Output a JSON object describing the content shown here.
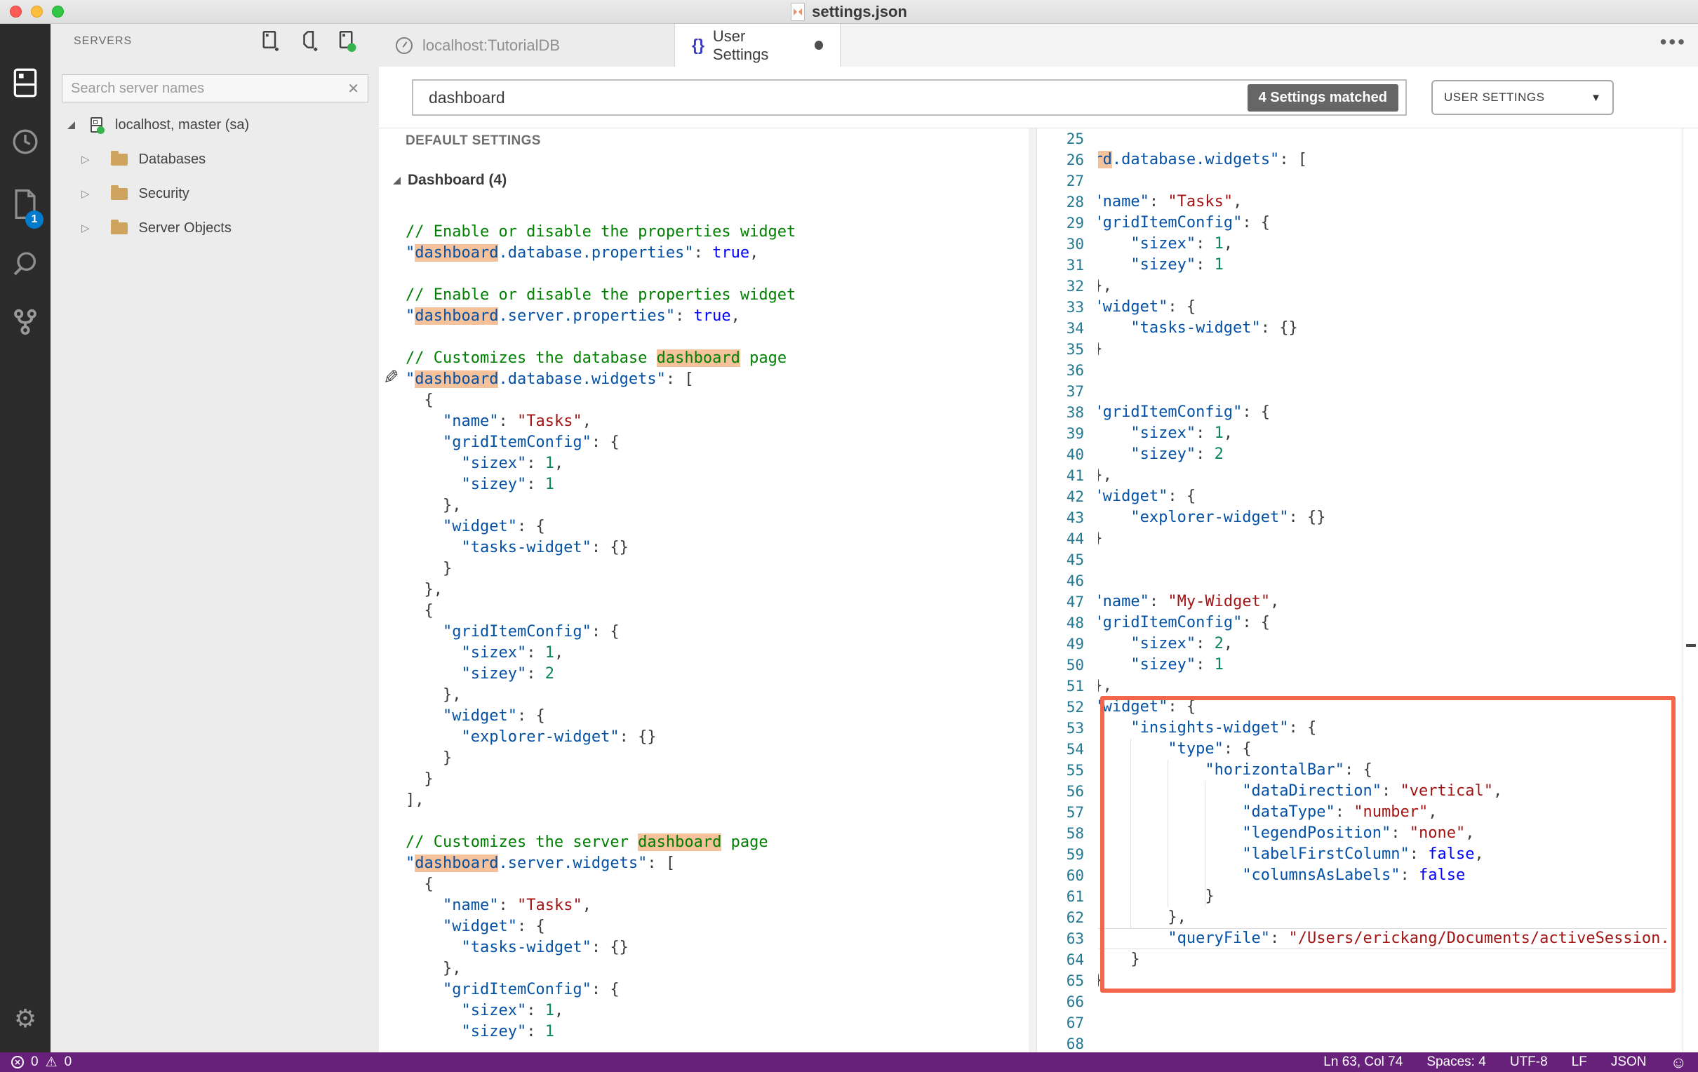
{
  "window": {
    "title": "settings.json"
  },
  "activity_bar": {
    "open_badge": "1"
  },
  "sidebar": {
    "title": "SERVERS",
    "search_placeholder": "Search server names",
    "tree": [
      {
        "label": "localhost, master (sa)"
      },
      {
        "label": "Databases"
      },
      {
        "label": "Security"
      },
      {
        "label": "Server Objects"
      }
    ]
  },
  "tabs": {
    "tab1": {
      "label": "localhost:TutorialDB"
    },
    "tab2": {
      "label": "User Settings"
    }
  },
  "settings_editor": {
    "query": "dashboard",
    "matched_badge": "4 Settings matched",
    "scope": "USER SETTINGS",
    "scope_caret": "▼"
  },
  "left_pane": {
    "header": "DEFAULT SETTINGS",
    "group_label": "Dashboard (4)",
    "lines": [
      [
        [
          "c",
          "// Enable or disable the properties widget"
        ]
      ],
      [
        [
          "k",
          "\""
        ],
        [
          "hk",
          "dashboard"
        ],
        [
          "k",
          ".database.properties\""
        ],
        [
          "p",
          ": "
        ],
        [
          "b",
          "true"
        ],
        [
          "p",
          ","
        ]
      ],
      [],
      [
        [
          "c",
          "// Enable or disable the properties widget"
        ]
      ],
      [
        [
          "k",
          "\""
        ],
        [
          "hk",
          "dashboard"
        ],
        [
          "k",
          ".server.properties\""
        ],
        [
          "p",
          ": "
        ],
        [
          "b",
          "true"
        ],
        [
          "p",
          ","
        ]
      ],
      [],
      [
        [
          "c",
          "// Customizes the database "
        ],
        [
          "hc",
          "dashboard"
        ],
        [
          "c",
          " page"
        ]
      ],
      [
        [
          "k",
          "\""
        ],
        [
          "hk",
          "dashboard"
        ],
        [
          "k",
          ".database.widgets\""
        ],
        [
          "p",
          ": ["
        ]
      ],
      [
        [
          "p",
          "  {"
        ]
      ],
      [
        [
          "p",
          "    "
        ],
        [
          "k",
          "\"name\""
        ],
        [
          "p",
          ": "
        ],
        [
          "s",
          "\"Tasks\""
        ],
        [
          "p",
          ","
        ]
      ],
      [
        [
          "p",
          "    "
        ],
        [
          "k",
          "\"gridItemConfig\""
        ],
        [
          "p",
          ": {"
        ]
      ],
      [
        [
          "p",
          "      "
        ],
        [
          "k",
          "\"sizex\""
        ],
        [
          "p",
          ": "
        ],
        [
          "n",
          "1"
        ],
        [
          "p",
          ","
        ]
      ],
      [
        [
          "p",
          "      "
        ],
        [
          "k",
          "\"sizey\""
        ],
        [
          "p",
          ": "
        ],
        [
          "n",
          "1"
        ]
      ],
      [
        [
          "p",
          "    },"
        ]
      ],
      [
        [
          "p",
          "    "
        ],
        [
          "k",
          "\"widget\""
        ],
        [
          "p",
          ": {"
        ]
      ],
      [
        [
          "p",
          "      "
        ],
        [
          "k",
          "\"tasks-widget\""
        ],
        [
          "p",
          ": {}"
        ]
      ],
      [
        [
          "p",
          "    }"
        ]
      ],
      [
        [
          "p",
          "  },"
        ]
      ],
      [
        [
          "p",
          "  {"
        ]
      ],
      [
        [
          "p",
          "    "
        ],
        [
          "k",
          "\"gridItemConfig\""
        ],
        [
          "p",
          ": {"
        ]
      ],
      [
        [
          "p",
          "      "
        ],
        [
          "k",
          "\"sizex\""
        ],
        [
          "p",
          ": "
        ],
        [
          "n",
          "1"
        ],
        [
          "p",
          ","
        ]
      ],
      [
        [
          "p",
          "      "
        ],
        [
          "k",
          "\"sizey\""
        ],
        [
          "p",
          ": "
        ],
        [
          "n",
          "2"
        ]
      ],
      [
        [
          "p",
          "    },"
        ]
      ],
      [
        [
          "p",
          "    "
        ],
        [
          "k",
          "\"widget\""
        ],
        [
          "p",
          ": {"
        ]
      ],
      [
        [
          "p",
          "      "
        ],
        [
          "k",
          "\"explorer-widget\""
        ],
        [
          "p",
          ": {}"
        ]
      ],
      [
        [
          "p",
          "    }"
        ]
      ],
      [
        [
          "p",
          "  }"
        ]
      ],
      [
        [
          "p",
          "],"
        ]
      ],
      [],
      [
        [
          "c",
          "// Customizes the server "
        ],
        [
          "hc",
          "dashboard"
        ],
        [
          "c",
          " page"
        ]
      ],
      [
        [
          "k",
          "\""
        ],
        [
          "hk",
          "dashboard"
        ],
        [
          "k",
          ".server.widgets\""
        ],
        [
          "p",
          ": ["
        ]
      ],
      [
        [
          "p",
          "  {"
        ]
      ],
      [
        [
          "p",
          "    "
        ],
        [
          "k",
          "\"name\""
        ],
        [
          "p",
          ": "
        ],
        [
          "s",
          "\"Tasks\""
        ],
        [
          "p",
          ","
        ]
      ],
      [
        [
          "p",
          "    "
        ],
        [
          "k",
          "\"widget\""
        ],
        [
          "p",
          ": {"
        ]
      ],
      [
        [
          "p",
          "      "
        ],
        [
          "k",
          "\"tasks-widget\""
        ],
        [
          "p",
          ": {}"
        ]
      ],
      [
        [
          "p",
          "    },"
        ]
      ],
      [
        [
          "p",
          "    "
        ],
        [
          "k",
          "\"gridItemConfig\""
        ],
        [
          "p",
          ": {"
        ]
      ],
      [
        [
          "p",
          "      "
        ],
        [
          "k",
          "\"sizex\""
        ],
        [
          "p",
          ": "
        ],
        [
          "n",
          "1"
        ],
        [
          "p",
          ","
        ]
      ],
      [
        [
          "p",
          "      "
        ],
        [
          "k",
          "\"sizey\""
        ],
        [
          "p",
          ": "
        ],
        [
          "n",
          "1"
        ]
      ]
    ]
  },
  "right_pane": {
    "clip_columns": 12.5,
    "lines": [
      [
        25,
        []
      ],
      [
        26,
        [
          [
            "p",
            "    "
          ],
          [
            "k",
            "\""
          ],
          [
            "hk",
            "dashboard"
          ],
          [
            "k",
            ".database.widgets\""
          ],
          [
            "p",
            ": ["
          ]
        ]
      ],
      [
        27,
        [
          [
            "p",
            "        {"
          ]
        ]
      ],
      [
        28,
        [
          [
            "p",
            "            "
          ],
          [
            "k",
            "\"name\""
          ],
          [
            "p",
            ": "
          ],
          [
            "s",
            "\"Tasks\""
          ],
          [
            "p",
            ","
          ]
        ]
      ],
      [
        29,
        [
          [
            "p",
            "            "
          ],
          [
            "k",
            "\"gridItemConfig\""
          ],
          [
            "p",
            ": {"
          ]
        ]
      ],
      [
        30,
        [
          [
            "p",
            "                "
          ],
          [
            "k",
            "\"sizex\""
          ],
          [
            "p",
            ": "
          ],
          [
            "n",
            "1"
          ],
          [
            "p",
            ","
          ]
        ]
      ],
      [
        31,
        [
          [
            "p",
            "                "
          ],
          [
            "k",
            "\"sizey\""
          ],
          [
            "p",
            ": "
          ],
          [
            "n",
            "1"
          ]
        ]
      ],
      [
        32,
        [
          [
            "p",
            "            },"
          ]
        ]
      ],
      [
        33,
        [
          [
            "p",
            "            "
          ],
          [
            "k",
            "\"widget\""
          ],
          [
            "p",
            ": {"
          ]
        ]
      ],
      [
        34,
        [
          [
            "p",
            "                "
          ],
          [
            "k",
            "\"tasks-widget\""
          ],
          [
            "p",
            ": {}"
          ]
        ]
      ],
      [
        35,
        [
          [
            "p",
            "            }"
          ]
        ]
      ],
      [
        36,
        [
          [
            "p",
            "        },"
          ]
        ]
      ],
      [
        37,
        [
          [
            "p",
            "        {"
          ]
        ]
      ],
      [
        38,
        [
          [
            "p",
            "            "
          ],
          [
            "k",
            "\"gridItemConfig\""
          ],
          [
            "p",
            ": {"
          ]
        ]
      ],
      [
        39,
        [
          [
            "p",
            "                "
          ],
          [
            "k",
            "\"sizex\""
          ],
          [
            "p",
            ": "
          ],
          [
            "n",
            "1"
          ],
          [
            "p",
            ","
          ]
        ]
      ],
      [
        40,
        [
          [
            "p",
            "                "
          ],
          [
            "k",
            "\"sizey\""
          ],
          [
            "p",
            ": "
          ],
          [
            "n",
            "2"
          ]
        ]
      ],
      [
        41,
        [
          [
            "p",
            "            },"
          ]
        ]
      ],
      [
        42,
        [
          [
            "p",
            "            "
          ],
          [
            "k",
            "\"widget\""
          ],
          [
            "p",
            ": {"
          ]
        ]
      ],
      [
        43,
        [
          [
            "p",
            "                "
          ],
          [
            "k",
            "\"explorer-widget\""
          ],
          [
            "p",
            ": {}"
          ]
        ]
      ],
      [
        44,
        [
          [
            "p",
            "            }"
          ]
        ]
      ],
      [
        45,
        [
          [
            "p",
            "        },"
          ]
        ]
      ],
      [
        46,
        [
          [
            "p",
            "        {"
          ]
        ]
      ],
      [
        47,
        [
          [
            "p",
            "            "
          ],
          [
            "k",
            "\"name\""
          ],
          [
            "p",
            ": "
          ],
          [
            "s",
            "\"My-Widget\""
          ],
          [
            "p",
            ","
          ]
        ]
      ],
      [
        48,
        [
          [
            "p",
            "            "
          ],
          [
            "k",
            "\"gridItemConfig\""
          ],
          [
            "p",
            ": {"
          ]
        ]
      ],
      [
        49,
        [
          [
            "p",
            "                "
          ],
          [
            "k",
            "\"sizex\""
          ],
          [
            "p",
            ": "
          ],
          [
            "n",
            "2"
          ],
          [
            "p",
            ","
          ]
        ]
      ],
      [
        50,
        [
          [
            "p",
            "                "
          ],
          [
            "k",
            "\"sizey\""
          ],
          [
            "p",
            ": "
          ],
          [
            "n",
            "1"
          ]
        ]
      ],
      [
        51,
        [
          [
            "p",
            "            },"
          ]
        ]
      ],
      [
        52,
        [
          [
            "p",
            "            "
          ],
          [
            "k",
            "\"widget\""
          ],
          [
            "p",
            ": {"
          ]
        ]
      ],
      [
        53,
        [
          [
            "p",
            "                "
          ],
          [
            "k",
            "\"insights-widget\""
          ],
          [
            "p",
            ": {"
          ]
        ]
      ],
      [
        54,
        [
          [
            "p",
            "                    "
          ],
          [
            "k",
            "\"type\""
          ],
          [
            "p",
            ": {"
          ]
        ]
      ],
      [
        55,
        [
          [
            "p",
            "                        "
          ],
          [
            "k",
            "\"horizontalBar\""
          ],
          [
            "p",
            ": {"
          ]
        ]
      ],
      [
        56,
        [
          [
            "p",
            "                            "
          ],
          [
            "k",
            "\"dataDirection\""
          ],
          [
            "p",
            ": "
          ],
          [
            "s",
            "\"vertical\""
          ],
          [
            "p",
            ","
          ]
        ]
      ],
      [
        57,
        [
          [
            "p",
            "                            "
          ],
          [
            "k",
            "\"dataType\""
          ],
          [
            "p",
            ": "
          ],
          [
            "s",
            "\"number\""
          ],
          [
            "p",
            ","
          ]
        ]
      ],
      [
        58,
        [
          [
            "p",
            "                            "
          ],
          [
            "k",
            "\"legendPosition\""
          ],
          [
            "p",
            ": "
          ],
          [
            "s",
            "\"none\""
          ],
          [
            "p",
            ","
          ]
        ]
      ],
      [
        59,
        [
          [
            "p",
            "                            "
          ],
          [
            "k",
            "\"labelFirstColumn\""
          ],
          [
            "p",
            ": "
          ],
          [
            "b",
            "false"
          ],
          [
            "p",
            ","
          ]
        ]
      ],
      [
        60,
        [
          [
            "p",
            "                            "
          ],
          [
            "k",
            "\"columnsAsLabels\""
          ],
          [
            "p",
            ": "
          ],
          [
            "b",
            "false"
          ]
        ]
      ],
      [
        61,
        [
          [
            "p",
            "                        }"
          ]
        ]
      ],
      [
        62,
        [
          [
            "p",
            "                    },"
          ]
        ]
      ],
      [
        63,
        [
          [
            "p",
            "                    "
          ],
          [
            "k",
            "\"queryFile\""
          ],
          [
            "p",
            ": "
          ],
          [
            "s",
            "\"/Users/erickang/Documents/activeSession.sql\""
          ]
        ]
      ],
      [
        64,
        [
          [
            "p",
            "                }"
          ]
        ]
      ],
      [
        65,
        [
          [
            "p",
            "            }"
          ]
        ]
      ],
      [
        66,
        [
          [
            "p",
            "        }"
          ]
        ]
      ],
      [
        67,
        [
          [
            "p",
            "    ],"
          ]
        ]
      ],
      [
        68,
        []
      ]
    ]
  },
  "status_bar": {
    "errors_count": "0",
    "warnings_count": "0",
    "cursor": "Ln 63, Col 74",
    "indent": "Spaces: 4",
    "encoding": "UTF-8",
    "eol": "LF",
    "language": "JSON"
  },
  "colors": {
    "status_bar": "#68217A",
    "activity_badge": "#007ACC",
    "find_highlight": "#F6C29C",
    "annotation_box": "#F4664B",
    "line_number": "#237893"
  }
}
